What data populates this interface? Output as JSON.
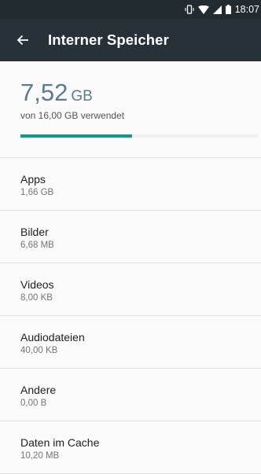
{
  "status_bar": {
    "time": "18:07",
    "icons": [
      "vibrate-icon",
      "wifi-icon",
      "signal-icon",
      "battery-icon"
    ]
  },
  "app_bar": {
    "title": "Interner Speicher",
    "back_icon": "arrow-back-icon",
    "color": "#263238"
  },
  "summary": {
    "used_value": "7,52",
    "used_unit": "GB",
    "subtitle": "von 16,00 GB verwendet",
    "progress_fraction": 0.47,
    "accent_color": "#0d9a8a"
  },
  "categories": [
    {
      "label": "Apps",
      "value": "1,66 GB"
    },
    {
      "label": "Bilder",
      "value": "6,68 MB"
    },
    {
      "label": "Videos",
      "value": "8,00 KB"
    },
    {
      "label": "Audiodateien",
      "value": "40,00 KB"
    },
    {
      "label": "Andere",
      "value": "0,00 B"
    },
    {
      "label": "Daten im Cache",
      "value": "10,20 MB"
    }
  ]
}
